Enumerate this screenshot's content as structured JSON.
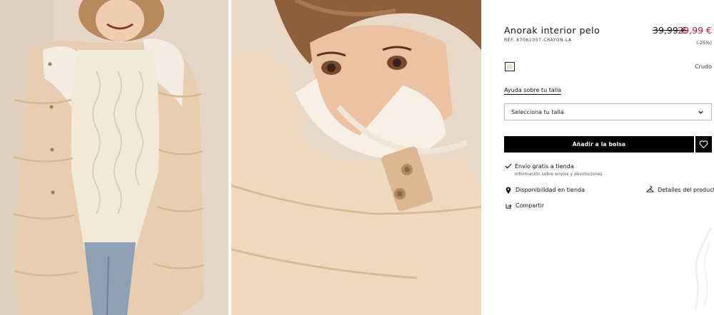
{
  "product": {
    "title": "Anorak interior pelo",
    "ref": "REF. 87061057-CRAYON-LA",
    "old_price": "39,99 €",
    "new_price": "29,99 €",
    "discount": "(-25%)"
  },
  "color": {
    "selected_name": "Crudo",
    "swatch_hex": "#ecdfcf"
  },
  "size": {
    "help_link": "Ayuda sobre tu talla",
    "select_placeholder": "Selecciona tu talla"
  },
  "actions": {
    "add_to_bag": "Añadir a la bolsa"
  },
  "shipping": {
    "title": "Envío gratis a tienda",
    "subtitle": "Información sobre envíos y devoluciones"
  },
  "links": {
    "availability": "Disponibilidad en tienda",
    "details": "Detalles del producto",
    "share": "Compartir"
  },
  "colors": {
    "sale": "#c8102e",
    "button": "#000000"
  }
}
